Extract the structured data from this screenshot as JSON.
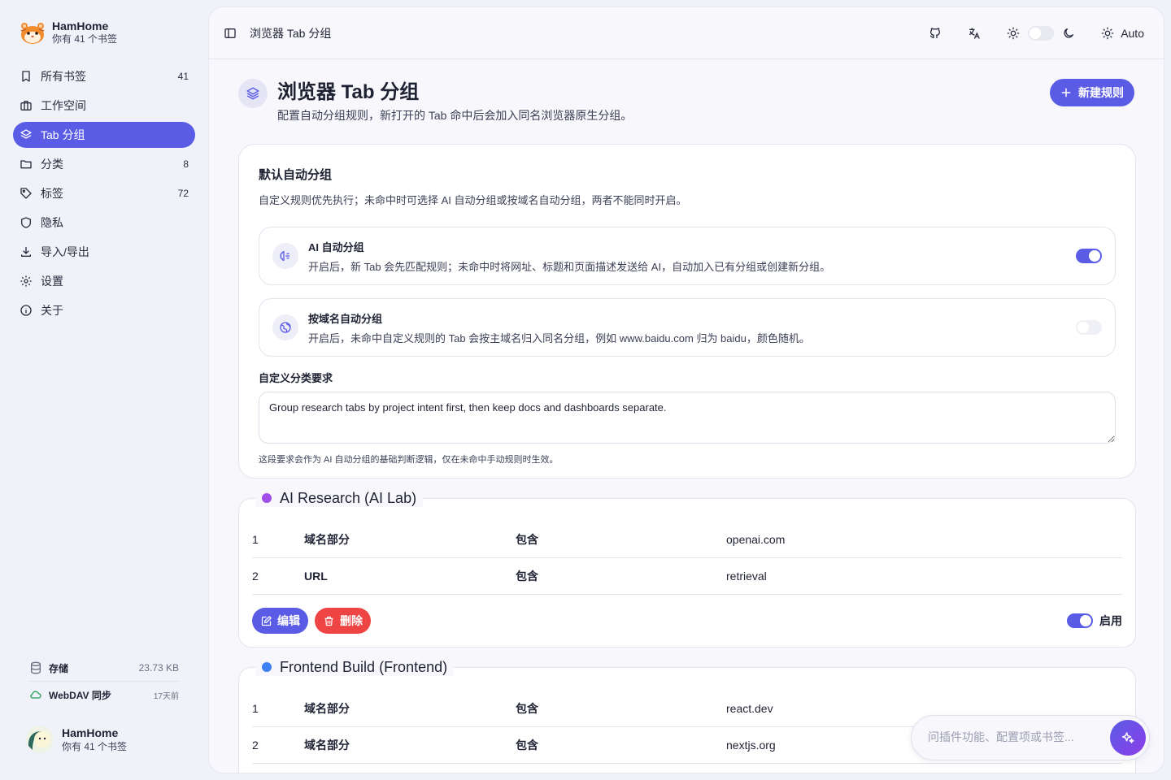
{
  "brand": {
    "name": "HamHome",
    "subtitle": "你有 41 个书签"
  },
  "sidebar": {
    "items": [
      {
        "label": "所有书签",
        "count": "41",
        "icon": "bookmark-icon"
      },
      {
        "label": "工作空间",
        "count": "",
        "icon": "briefcase-icon"
      },
      {
        "label": "Tab 分组",
        "count": "",
        "icon": "layers-icon",
        "active": true
      },
      {
        "label": "分类",
        "count": "8",
        "icon": "folder-icon"
      },
      {
        "label": "标签",
        "count": "72",
        "icon": "tag-icon"
      },
      {
        "label": "隐私",
        "count": "",
        "icon": "shield-icon"
      },
      {
        "label": "导入/导出",
        "count": "",
        "icon": "download-icon"
      },
      {
        "label": "设置",
        "count": "",
        "icon": "gear-icon"
      },
      {
        "label": "关于",
        "count": "",
        "icon": "info-icon"
      }
    ],
    "footer": {
      "storage_label": "存储",
      "storage_value": "23.73 KB",
      "sync_label": "WebDAV 同步",
      "sync_value": "17天前"
    },
    "user": {
      "name": "HamHome",
      "subtitle": "你有 41 个书签"
    }
  },
  "topbar": {
    "breadcrumb": "浏览器 Tab 分组",
    "theme_mode": "Auto"
  },
  "page": {
    "title": "浏览器 Tab 分组",
    "description": "配置自动分组规则，新打开的 Tab 命中后会加入同名浏览器原生分组。",
    "new_rule_label": "新建规则"
  },
  "defaults": {
    "title": "默认自动分组",
    "description": "自定义规则优先执行；未命中时可选择 AI 自动分组或按域名自动分组，两者不能同时开启。",
    "options": [
      {
        "title": "AI 自动分组",
        "description": "开启后，新 Tab 会先匹配规则；未命中时将网址、标题和页面描述发送给 AI，自动加入已有分组或创建新分组。",
        "enabled": true
      },
      {
        "title": "按域名自动分组",
        "description": "开启后，未命中自定义规则的 Tab 会按主域名归入同名分组，例如 www.baidu.com 归为 baidu，颜色随机。",
        "enabled": false
      }
    ],
    "custom_label": "自定义分类要求",
    "custom_value": "Group research tabs by project intent first, then keep docs and dashboards separate.",
    "custom_hint": "这段要求会作为 AI 自动分组的基础判断逻辑，仅在未命中手动规则时生效。"
  },
  "groups": [
    {
      "name": "AI Research (AI Lab)",
      "color": "#a04ee8",
      "rules": [
        {
          "index": "1",
          "field": "域名部分",
          "op": "包含",
          "value": "openai.com"
        },
        {
          "index": "2",
          "field": "URL",
          "op": "包含",
          "value": "retrieval"
        }
      ],
      "edit_label": "编辑",
      "delete_label": "删除",
      "enable_label": "启用",
      "enabled": true
    },
    {
      "name": "Frontend Build (Frontend)",
      "color": "#3b82f6",
      "rules": [
        {
          "index": "1",
          "field": "域名部分",
          "op": "包含",
          "value": "react.dev"
        },
        {
          "index": "2",
          "field": "域名部分",
          "op": "包含",
          "value": "nextjs.org"
        }
      ]
    }
  ],
  "ask": {
    "placeholder": "问插件功能、配置项或书签..."
  },
  "colors": {
    "accent": "#5b5ce6",
    "danger": "#ef4444",
    "ai_group": "#a04ee8",
    "frontend_group": "#3b82f6"
  }
}
